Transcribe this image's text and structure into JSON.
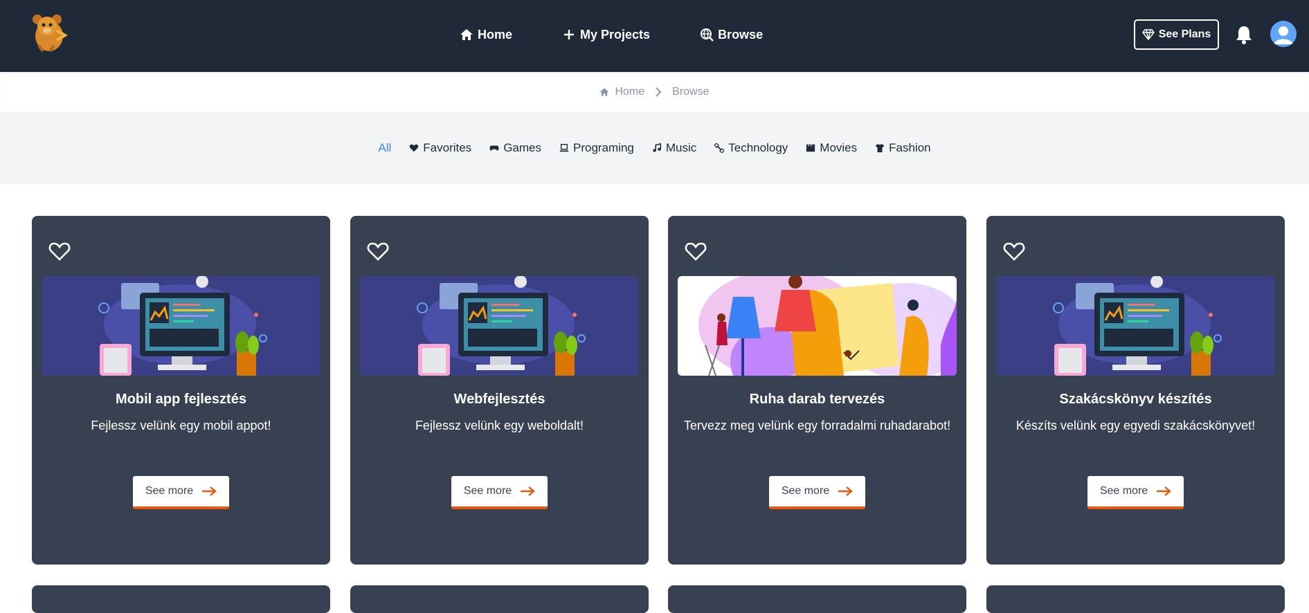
{
  "header": {
    "nav": [
      {
        "label": "Home",
        "icon": "home-icon"
      },
      {
        "label": "My Projects",
        "icon": "plus-icon"
      },
      {
        "label": "Browse",
        "icon": "globe-search-icon"
      }
    ],
    "plans_label": "See Plans"
  },
  "breadcrumb": {
    "home": "Home",
    "current": "Browse"
  },
  "categories": [
    {
      "label": "All",
      "active": true
    },
    {
      "label": "Favorites",
      "icon": "heart-icon"
    },
    {
      "label": "Games",
      "icon": "gamepad-icon"
    },
    {
      "label": "Programing",
      "icon": "laptop-icon"
    },
    {
      "label": "Music",
      "icon": "music-icon"
    },
    {
      "label": "Technology",
      "icon": "satellite-icon"
    },
    {
      "label": "Movies",
      "icon": "clapperboard-icon"
    },
    {
      "label": "Fashion",
      "icon": "shirt-icon"
    }
  ],
  "cards": [
    {
      "title": "Mobil app fejlesztés",
      "desc": "Fejlessz velünk egy mobil appot!",
      "more": "See more",
      "image": "developer-illustration"
    },
    {
      "title": "Webfejlesztés",
      "desc": "Fejlessz velünk egy weboldalt!",
      "more": "See more",
      "image": "developer-illustration"
    },
    {
      "title": "Ruha darab tervezés",
      "desc": "Tervezz meg velünk egy forradalmi ruhadarabot!",
      "more": "See more",
      "image": "fashion-illustration"
    },
    {
      "title": "Szakácskönyv készítés",
      "desc": "Készíts velünk egy egyedi szakácskönyvet!",
      "more": "See more",
      "image": "developer-illustration"
    }
  ],
  "colors": {
    "header_bg": "#1f2937",
    "card_bg": "#374151",
    "accent": "#3b82f6",
    "button_underline": "#ea580c"
  }
}
